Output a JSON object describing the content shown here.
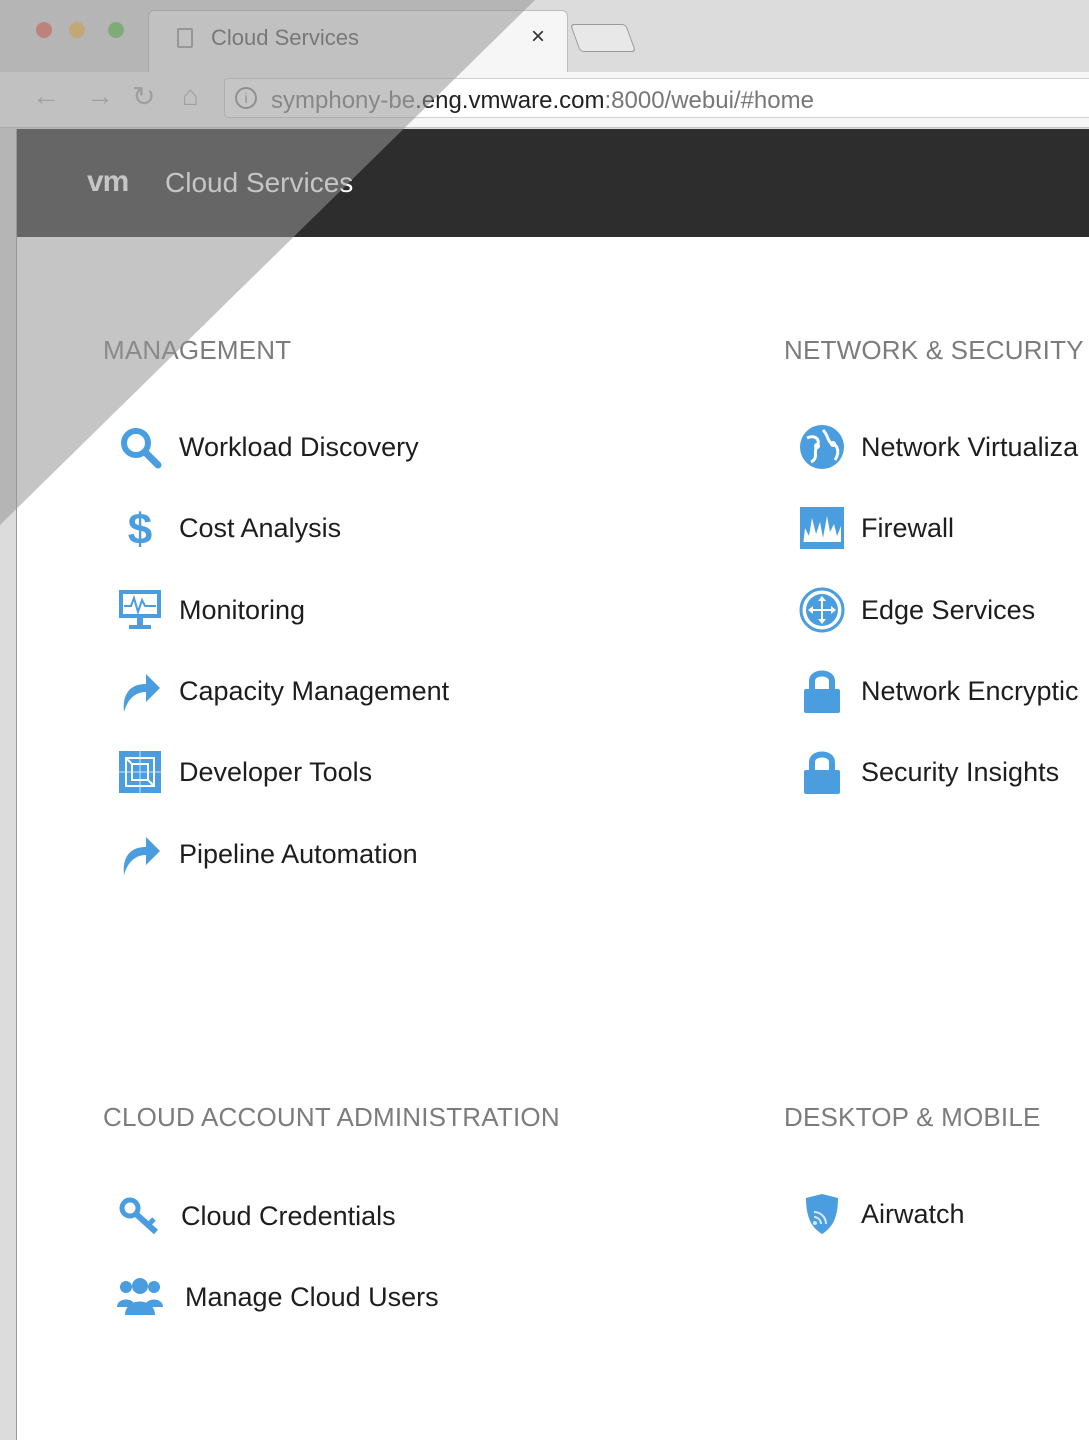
{
  "browser": {
    "tab_title": "Cloud Services",
    "tab_close": "×",
    "url_prefix": "symphony-be",
    "url_host": ".eng.vmware.com",
    "url_path": ":8000/webui/#home",
    "nav": {
      "back": "←",
      "forward": "→",
      "reload": "↻",
      "home": "⌂"
    },
    "info_glyph": "i"
  },
  "app": {
    "logo": "vm",
    "title": "Cloud Services"
  },
  "colors": {
    "accent_blue": "#4a9ee0",
    "header_bg": "#2d2d2d",
    "section_title": "#7c7c7c"
  },
  "sections": {
    "management": {
      "title": "MANAGEMENT",
      "items": [
        {
          "label": "Workload Discovery",
          "icon": "search-icon"
        },
        {
          "label": "Cost Analysis",
          "icon": "dollar-icon"
        },
        {
          "label": "Monitoring",
          "icon": "monitor-icon"
        },
        {
          "label": "Capacity Management",
          "icon": "share-arrow-icon"
        },
        {
          "label": "Developer Tools",
          "icon": "blueprint-icon"
        },
        {
          "label": "Pipeline Automation",
          "icon": "share-arrow-icon"
        }
      ]
    },
    "network": {
      "title": "NETWORK & SECURITY",
      "items": [
        {
          "label": "Network Virtualiza",
          "icon": "globe-icon"
        },
        {
          "label": "Firewall",
          "icon": "firewall-icon"
        },
        {
          "label": "Edge Services",
          "icon": "router-icon"
        },
        {
          "label": "Network Encryptic",
          "icon": "lock-icon"
        },
        {
          "label": "Security Insights",
          "icon": "lock-icon"
        }
      ]
    },
    "cloud_admin": {
      "title": "CLOUD ACCOUNT ADMINISTRATION",
      "items": [
        {
          "label": "Cloud Credentials",
          "icon": "key-icon"
        },
        {
          "label": "Manage Cloud Users",
          "icon": "users-icon"
        }
      ]
    },
    "desktop": {
      "title": "DESKTOP & MOBILE",
      "items": [
        {
          "label": "Airwatch",
          "icon": "shield-icon"
        }
      ]
    }
  }
}
